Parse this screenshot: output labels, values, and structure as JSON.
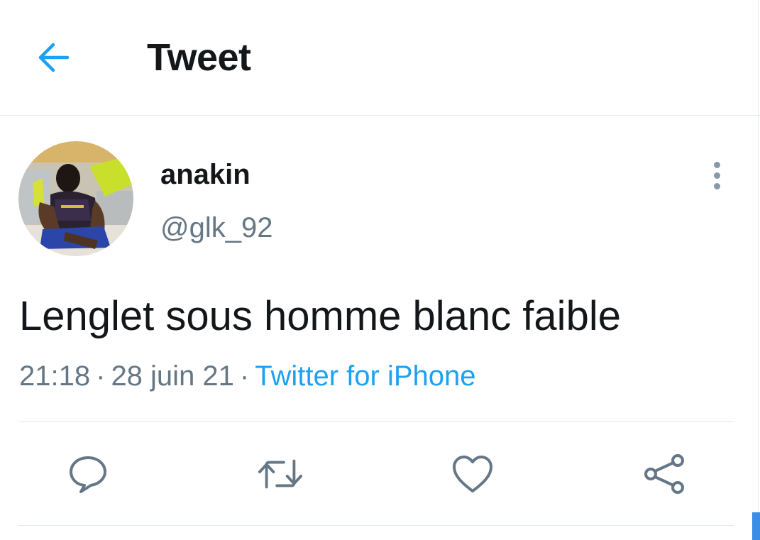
{
  "header": {
    "back_icon": "arrow-left-icon",
    "title": "Tweet"
  },
  "tweet": {
    "author": {
      "display_name": "anakin ",
      "handle": "@glk_92"
    },
    "text": "Lenglet sous homme blanc faible",
    "time": "21:18",
    "separator": "·",
    "date": "28 juin 21",
    "source": "Twitter for iPhone"
  },
  "actions": [
    {
      "name": "reply",
      "icon": "reply-icon"
    },
    {
      "name": "retweet",
      "icon": "retweet-icon"
    },
    {
      "name": "like",
      "icon": "heart-icon"
    },
    {
      "name": "share",
      "icon": "share-icon"
    }
  ],
  "colors": {
    "accent": "#1da1f2",
    "text": "#14171a",
    "secondary": "#657786",
    "icon": "#657786",
    "border": "#e1e8ed"
  }
}
